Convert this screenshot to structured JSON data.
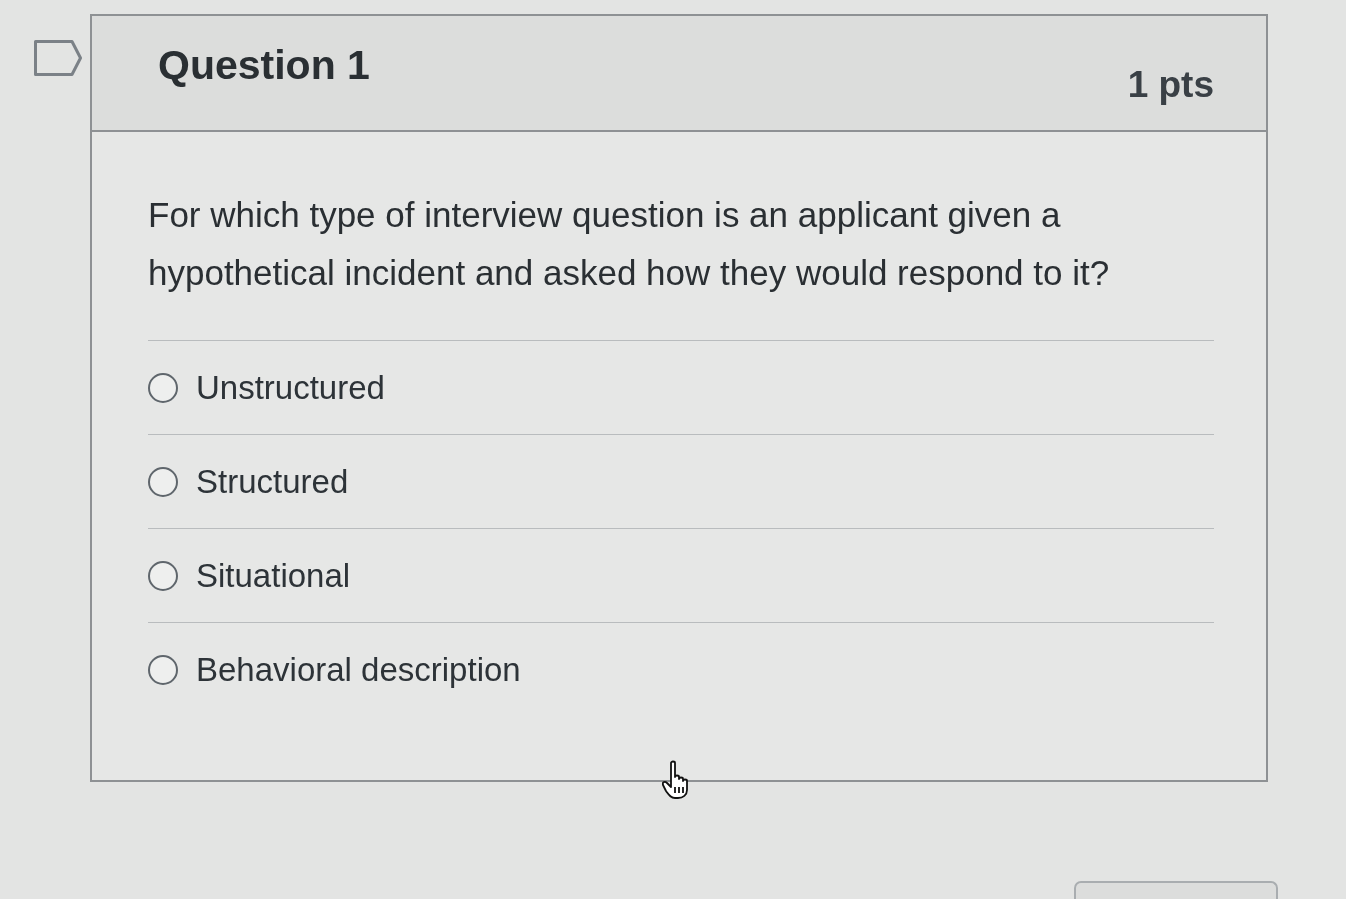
{
  "question": {
    "flagged": false,
    "title": "Question 1",
    "points": "1 pts",
    "text": "For which type of interview question is an applicant given a hypothetical incident and asked how they would respond to it?",
    "options": [
      {
        "label": "Unstructured",
        "selected": false
      },
      {
        "label": "Structured",
        "selected": false
      },
      {
        "label": "Situational",
        "selected": false
      },
      {
        "label": "Behavioral description",
        "selected": false
      }
    ]
  }
}
